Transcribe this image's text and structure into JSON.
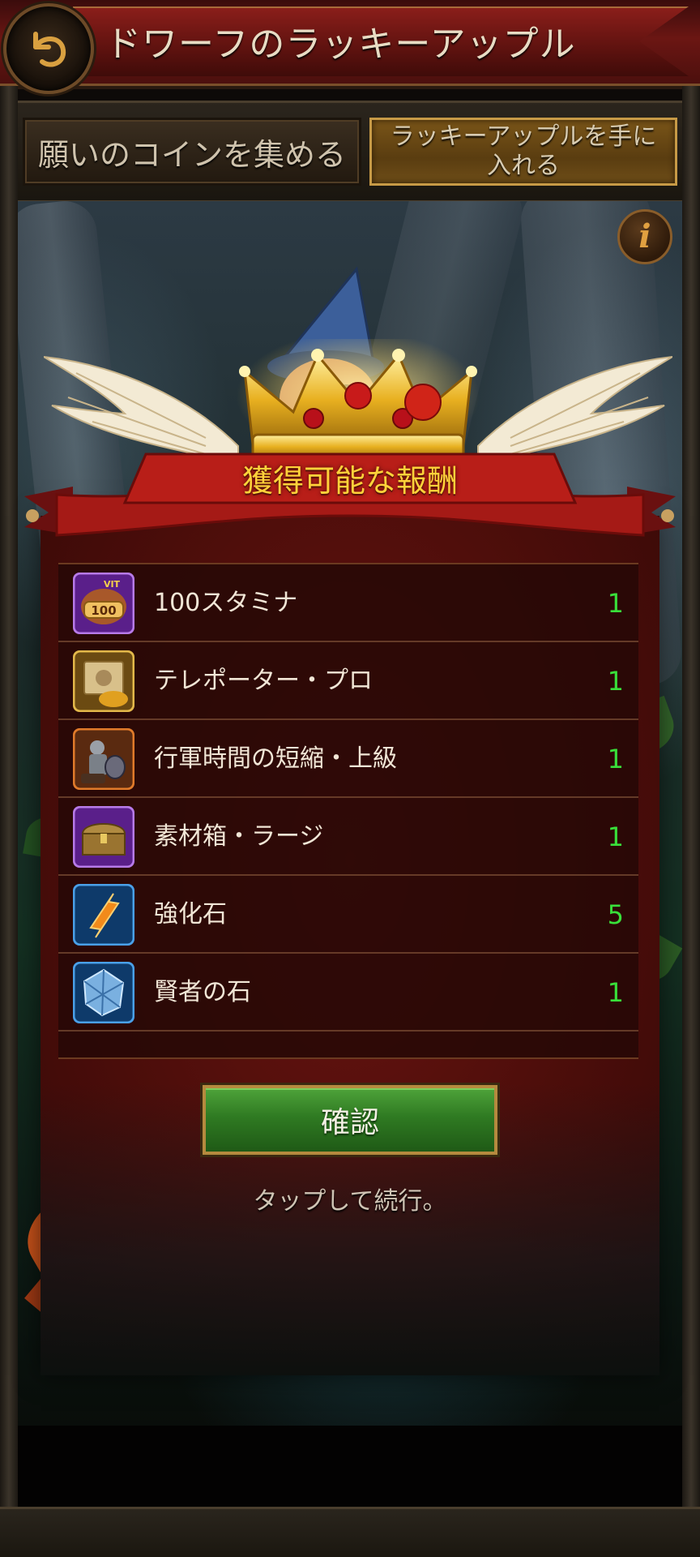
{
  "header": {
    "title": "ドワーフのラッキーアップル",
    "back_icon": "back-arrow-icon"
  },
  "tabs": [
    {
      "label": "願いのコインを集める",
      "active": false
    },
    {
      "label": "ラッキーアップルを手に入れる",
      "active": true
    }
  ],
  "info_icon": "i",
  "reward_panel": {
    "title": "獲得可能な報酬",
    "items": [
      {
        "name": "100スタミナ",
        "qty": "1",
        "icon": "stamina-100-icon",
        "frame": "purple",
        "badge": "100",
        "badge_top": "VIT"
      },
      {
        "name": "テレポーター・プロ",
        "qty": "1",
        "icon": "teleporter-scroll-icon",
        "frame": "gold"
      },
      {
        "name": "行軍時間の短縮・上級",
        "qty": "1",
        "icon": "march-speedup-icon",
        "frame": "orange"
      },
      {
        "name": "素材箱・ラージ",
        "qty": "1",
        "icon": "material-chest-icon",
        "frame": "purple"
      },
      {
        "name": "強化石",
        "qty": "5",
        "icon": "enhancement-stone-icon",
        "frame": "blue"
      },
      {
        "name": "賢者の石",
        "qty": "1",
        "icon": "sage-stone-icon",
        "frame": "blue"
      }
    ]
  },
  "confirm_label": "確認",
  "tap_hint": "タップして続行。",
  "colors": {
    "quantity": "#39e03a",
    "ribbon_title": "#ffd23a",
    "confirm_green": "#2f7a22"
  }
}
